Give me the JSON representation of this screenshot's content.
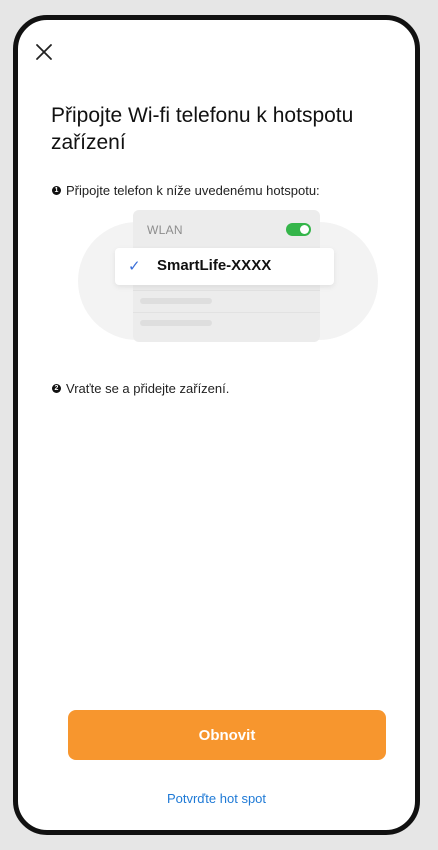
{
  "header": {
    "close_icon": "close-icon"
  },
  "title": "Připojte Wi-fi telefonu k hotspotu zařízení",
  "steps": [
    {
      "number": "1",
      "text": "Připojte telefon k níže uvedenému hotspotu:"
    },
    {
      "number": "2",
      "text": "Vraťte se a přidejte zařízení."
    }
  ],
  "illustration": {
    "wlan_label": "WLAN",
    "toggle_on": true,
    "check_icon": "checkmark-icon",
    "ssid": "SmartLife-XXXX"
  },
  "actions": {
    "refresh_label": "Obnovit",
    "confirm_hotspot_label": "Potvrďte hot spot"
  },
  "colors": {
    "accent": "#f7962e",
    "link": "#1f7ad6",
    "toggle": "#35b54a",
    "check": "#3b6fd8"
  }
}
